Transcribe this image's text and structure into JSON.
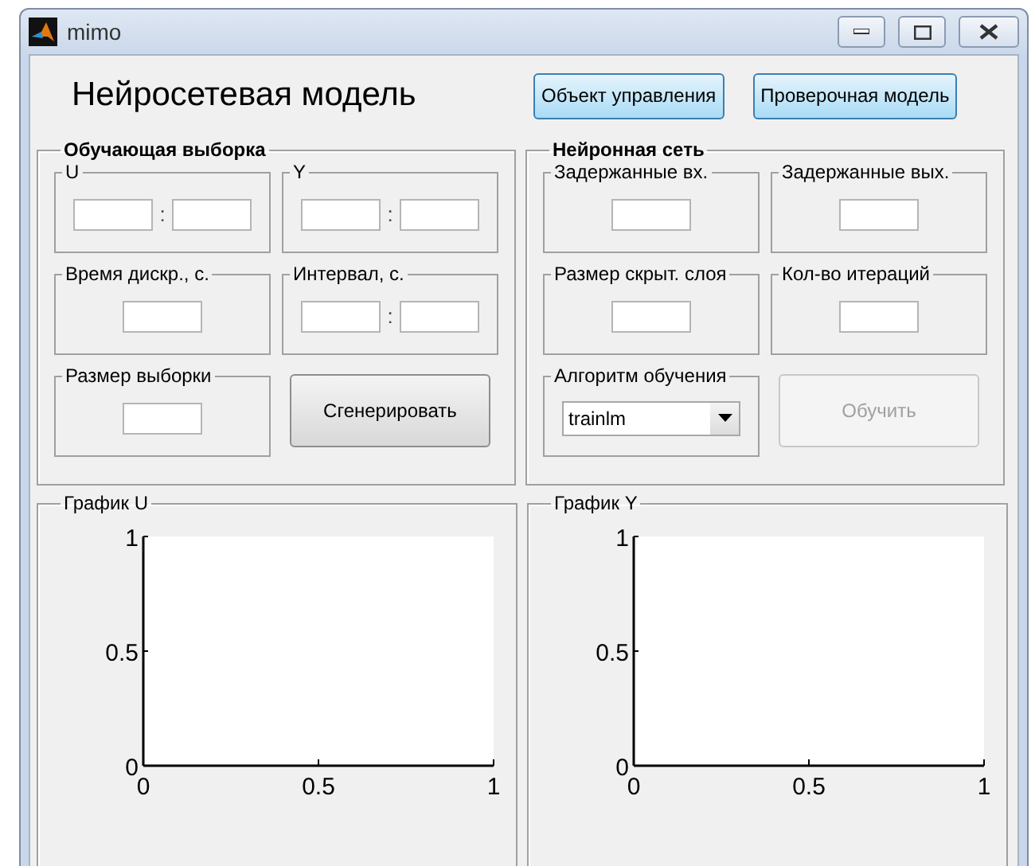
{
  "window": {
    "title": "mimo"
  },
  "title": "Нейросетевая модель",
  "buttons": [
    {
      "label": "Объект управления"
    },
    {
      "label": "Проверочная модель"
    }
  ],
  "training_set": {
    "title": "Обучающая выборка",
    "groups": [
      {
        "title": "U",
        "kind": "range",
        "separator": ":"
      },
      {
        "title": "Y",
        "kind": "range",
        "separator": ":"
      },
      {
        "title": "Время дискр., с.",
        "kind": "single"
      },
      {
        "title": "Интервал, с.",
        "kind": "range",
        "separator": ":"
      },
      {
        "title": "Размер выборки",
        "kind": "single"
      }
    ],
    "button": {
      "label": "Сгенерировать",
      "disabled": false
    }
  },
  "network": {
    "title": "Нейронная сеть",
    "groups": [
      {
        "title": "Задержанные вх.",
        "kind": "single"
      },
      {
        "title": "Задержанные вых.",
        "kind": "single"
      },
      {
        "title": "Размер скрыт. слоя",
        "kind": "single"
      },
      {
        "title": "Кол-во итераций",
        "kind": "single"
      }
    ],
    "algorithm": {
      "title": "Алгоритм обучения",
      "value": "trainlm"
    },
    "button": {
      "label": "Обучить",
      "disabled": true
    }
  },
  "plots": [
    {
      "title": "График U",
      "chart_data": {
        "type": "line",
        "xlim": [
          0,
          1
        ],
        "ylim": [
          0,
          1
        ],
        "xticks": [
          0,
          0.5,
          1
        ],
        "yticks": [
          0,
          0.5,
          1
        ]
      }
    },
    {
      "title": "График Y",
      "chart_data": {
        "type": "line",
        "xlim": [
          0,
          1
        ],
        "ylim": [
          0,
          1
        ],
        "xticks": [
          0,
          0.5,
          1
        ],
        "yticks": [
          0,
          0.5,
          1
        ]
      }
    }
  ]
}
